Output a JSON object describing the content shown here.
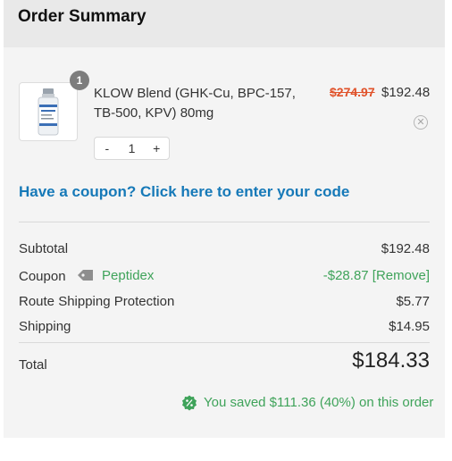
{
  "header": {
    "title": "Order Summary"
  },
  "item": {
    "quantity_badge": "1",
    "name": "KLOW Blend (GHK-Cu, BPC-157, TB-500, KPV) 80mg",
    "original_price": "$274.97",
    "price": "$192.48",
    "remove_icon": "close-circle-icon",
    "stepper": {
      "minus": "-",
      "quantity": "1",
      "plus": "+"
    }
  },
  "coupon_prompt": "Have a coupon? Click here to enter your code",
  "totals": {
    "subtotal_label": "Subtotal",
    "subtotal_value": "$192.48",
    "coupon_label": "Coupon",
    "coupon_code": "Peptidex",
    "coupon_discount": "-$28.87",
    "coupon_remove": "[Remove]",
    "route_label": "Route Shipping Protection",
    "route_value": "$5.77",
    "shipping_label": "Shipping",
    "shipping_value": "$14.95",
    "total_label": "Total",
    "total_value": "$184.33"
  },
  "savings_text": "You saved $111.36 (40%) on this order",
  "colors": {
    "accent_blue": "#1679b8",
    "sale_red": "#e0522a",
    "success_green": "#3fa35a"
  },
  "icons": {
    "coupon": "tag-icon",
    "savings": "percent-badge-icon",
    "product": "vial-image"
  }
}
